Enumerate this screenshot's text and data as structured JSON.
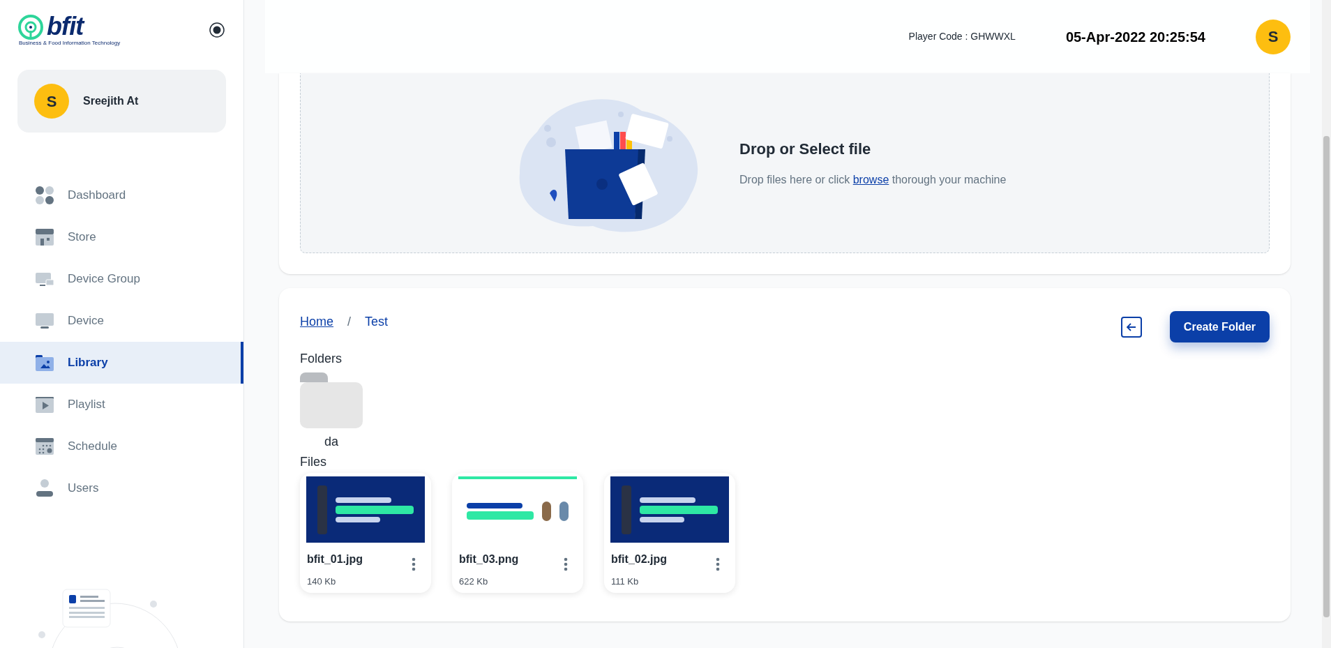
{
  "sidebar": {
    "brand": {
      "name": "bfit",
      "tagline": "Business & Food Information Technology"
    },
    "user": {
      "initial": "S",
      "name": "Sreejith At"
    },
    "items": [
      {
        "label": "Dashboard",
        "kind": "dashboard",
        "selected": false
      },
      {
        "label": "Store",
        "kind": "store",
        "selected": false
      },
      {
        "label": "Device Group",
        "kind": "devices",
        "selected": false
      },
      {
        "label": "Device",
        "kind": "monitor",
        "selected": false
      },
      {
        "label": "Library",
        "kind": "library",
        "selected": true
      },
      {
        "label": "Playlist",
        "kind": "play",
        "selected": false
      },
      {
        "label": "Schedule",
        "kind": "calendar",
        "selected": false
      },
      {
        "label": "Users",
        "kind": "user",
        "selected": false
      }
    ]
  },
  "header": {
    "player_code": "Player Code : GHWWXL",
    "datetime": "05-Apr-2022 20:25:54",
    "avatar_initial": "S"
  },
  "upload": {
    "title": "Drop or Select file",
    "before_link": "Drop files here or click ",
    "link": "browse",
    "after_link": " thorough your machine"
  },
  "browser": {
    "breadcrumb": [
      {
        "label": "Home",
        "link": true
      },
      {
        "label": "Test",
        "link": false
      }
    ],
    "separator": "/",
    "create_button": "Create Folder",
    "folders_heading": "Folders",
    "folders": [
      {
        "name": "da"
      }
    ],
    "files_heading": "Files",
    "files": [
      {
        "name": "bfit_01.jpg",
        "size": "140 Kb",
        "kind": "dark"
      },
      {
        "name": "bfit_03.png",
        "size": "622 Kb",
        "kind": "light"
      },
      {
        "name": "bfit_02.jpg",
        "size": "111 Kb",
        "kind": "dark"
      }
    ]
  }
}
